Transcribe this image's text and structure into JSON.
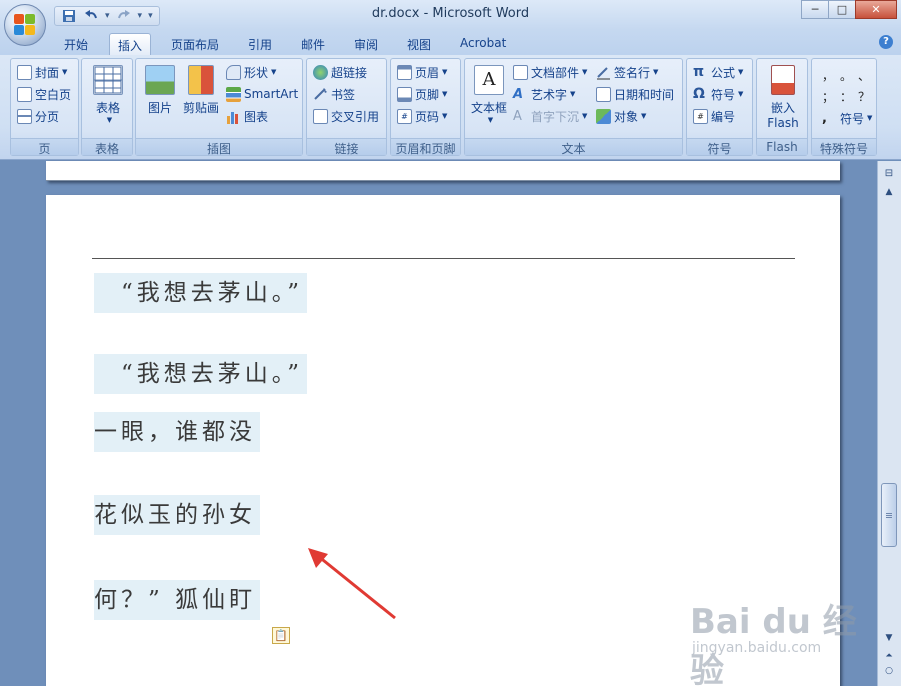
{
  "window": {
    "title": "dr.docx - Microsoft Word",
    "controls": {
      "minimize": "─",
      "maximize": "□",
      "close": "✕"
    }
  },
  "quick_access": {
    "more": "▾"
  },
  "tabs": [
    "开始",
    "插入",
    "页面布局",
    "引用",
    "邮件",
    "审阅",
    "视图",
    "Acrobat"
  ],
  "active_tab": "插入",
  "help_label": "?",
  "ribbon": {
    "page_group": {
      "label": "页",
      "items": [
        "封面",
        "空白页",
        "分页"
      ]
    },
    "table_group": {
      "label": "表格",
      "button": "表格"
    },
    "illustration_group": {
      "label": "插图",
      "picture": "图片",
      "clipart": "剪贴画",
      "shapes": "形状",
      "smartart": "SmartArt",
      "chart": "图表"
    },
    "links_group": {
      "label": "链接",
      "items": [
        "超链接",
        "书签",
        "交叉引用"
      ]
    },
    "header_footer_group": {
      "label": "页眉和页脚",
      "items": [
        "页眉",
        "页脚",
        "页码"
      ]
    },
    "text_group": {
      "label": "文本",
      "textbox": "文本框",
      "items_left": [
        "文档部件",
        "艺术字",
        "首字下沉"
      ],
      "items_right": [
        "签名行",
        "日期和时间",
        "对象"
      ]
    },
    "symbols_group": {
      "label": "符号",
      "items": [
        "公式",
        "符号",
        "编号"
      ]
    },
    "flash_group": {
      "label": "Flash",
      "button_line1": "嵌入",
      "button_line2": "Flash"
    },
    "special_group": {
      "label": "特殊符号",
      "chars": [
        "，",
        "。",
        "、",
        "；",
        "：",
        "？"
      ],
      "symbol": "符号"
    }
  },
  "document": {
    "paragraphs": [
      "　“我想去茅山。”",
      "　“我想去茅山。”",
      "一眼，谁都没",
      "花似玉的孙女",
      "何？” 狐仙盯"
    ]
  },
  "watermark": {
    "main": "Bai du 经验",
    "sub": "jingyan.baidu.com"
  },
  "colors": {
    "ribbon_text": "#15428b",
    "document_bg": "#6f8fba",
    "highlight": "#e3f0f7",
    "arrow": "#e03a33"
  }
}
